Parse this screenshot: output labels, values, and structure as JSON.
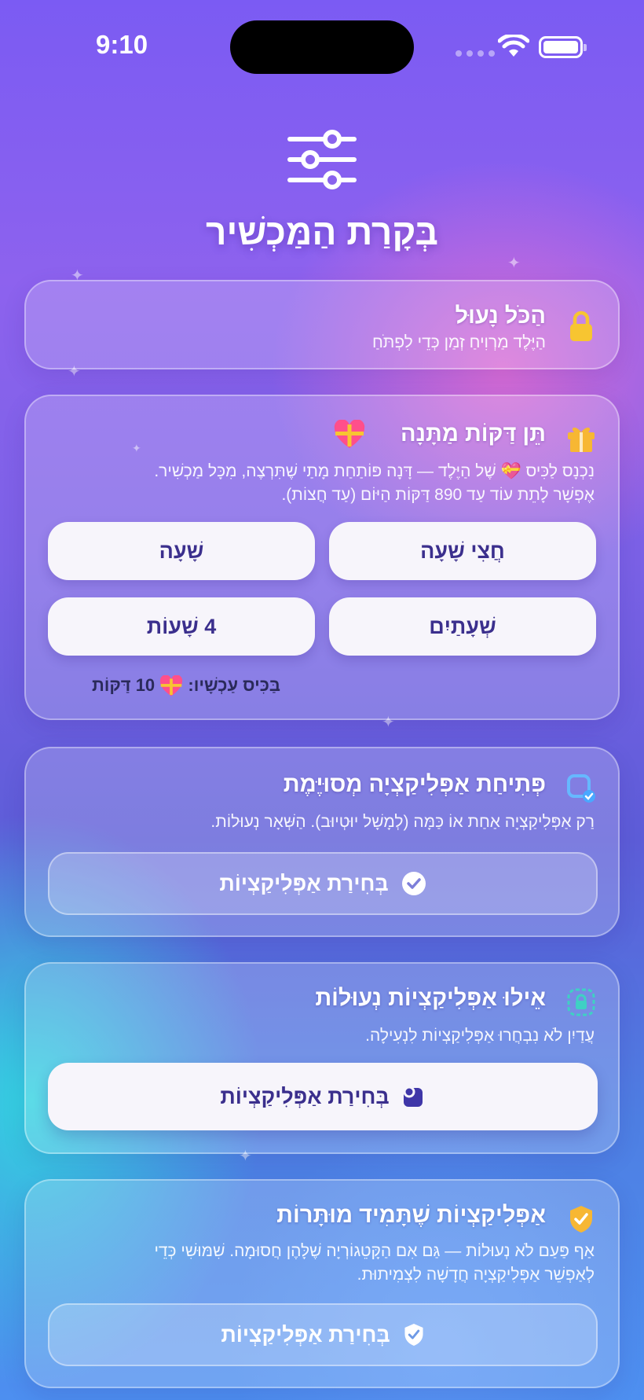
{
  "status_bar": {
    "time": "9:10"
  },
  "header": {
    "title": "בְּקָרַת הַמַּכְשִׁיר",
    "icon": "sliders-icon"
  },
  "lock_card": {
    "title": "הַכֹּל נָעוּל",
    "subtitle": "הַיֶּלֶד מַרְוִיחַ זְמַן כְּדֵי לִפְתֹּחַ",
    "icon": "lock-icon",
    "icon_color": "#F7C531"
  },
  "gift_card": {
    "title": "תֵּן דַּקּוֹת מַתָּנָה",
    "subtitle_line1": "נִכְנָס לַכִּיס 💝 שֶׁל הַיֶּלֶד — דָּנָה פּוֹתַחַת מָתַי שֶׁתִּרְצֶה, מִכָּל מַכְשִׁיר.",
    "subtitle_line2": "אֶפְשָׁר לָתֵת עוֹד עַד 890 דַּקּוֹת הַיּוֹם (עַד חֲצוֹת).",
    "icon": "gift-icon",
    "buttons": {
      "half_hour": "חֲצִי שָׁעָה",
      "hour": "שָׁעָה",
      "two_hours": "שְׁעָתַיִם",
      "four_hours": "4 שָׁעוֹת"
    },
    "pocket_label": "בַּכִּיס עַכְשָׁיו:",
    "pocket_value": "10 דַּקּוֹת"
  },
  "specific_app_card": {
    "title": "פְּתִיחַת אַפְּלִיקַצְיָה מְסוּיֶּמֶת",
    "subtitle": "רַק אַפְּלִיקַצְיָה אַחַת אוֹ כַּמָּה (לְמָשָׁל יוּטְיוּב). הַשְּׁאָר נְעוּלוֹת.",
    "icon": "app-check-icon",
    "button_label": "בְּחִירַת אַפְּלִיקַצְיוֹת",
    "button_icon": "checkmark-circle-icon"
  },
  "locked_apps_card": {
    "title": "אֵילוּ אַפְּלִיקַצְיוֹת נְעוּלוֹת",
    "subtitle": "עֲדַיִן לֹא נִבְחֲרוּ אַפְּלִיקַצְיוֹת לִנְעִילָה.",
    "icon": "app-lock-icon",
    "button_label": "בְּחִירַת אַפְּלִיקַצְיוֹת",
    "button_icon": "app-grid-icon"
  },
  "allowed_apps_card": {
    "title": "אַפְּלִיקַצְיוֹת שֶׁתָּמִיד מוּתָּרוֹת",
    "subtitle_line1": "אַף פַּעַם לֹא נְעוּלוֹת — גַּם אִם הַקָּטֵגוֹרְיָה שֶׁלָּהֶן חֲסוּמָה. שִׁמּוּשִׁי כְּדֵי",
    "subtitle_line2": "לְאַפְשֵׁר אַפְּלִיקַצְיָה חֲדָשָׁה לִצְמִיתוּת.",
    "icon": "shield-check-icon",
    "icon_color": "#F7B733",
    "button_label": "בְּחִירַת אַפְּלִיקַצְיוֹת",
    "button_icon": "shield-check-icon"
  }
}
